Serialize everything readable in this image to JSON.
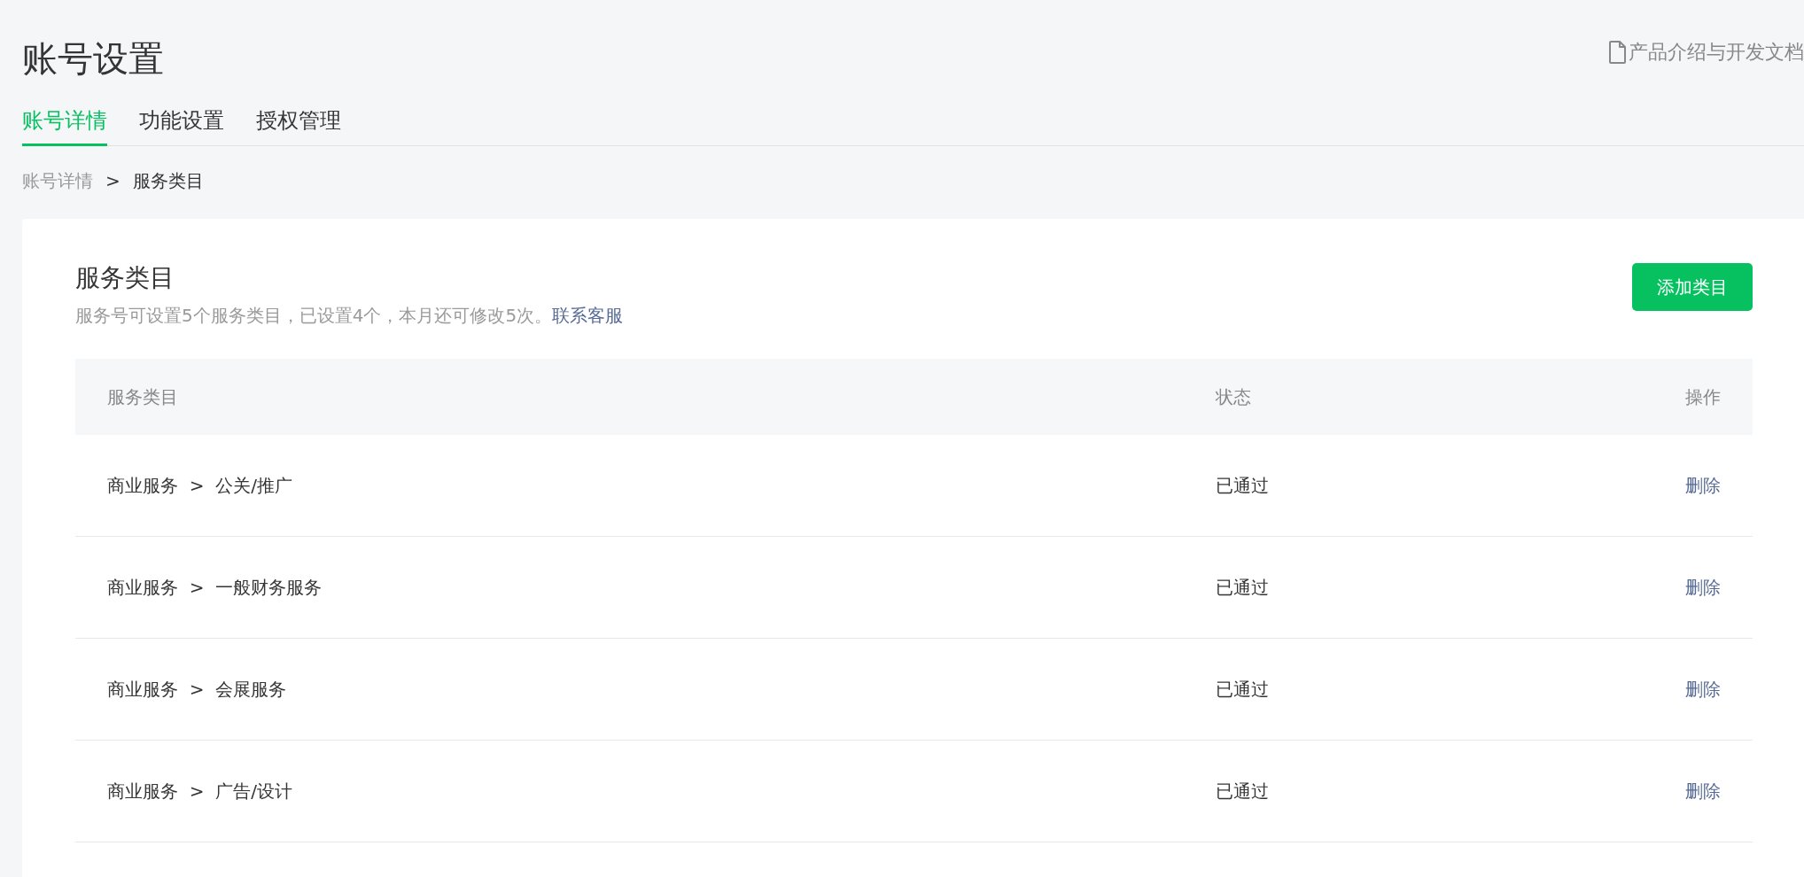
{
  "page": {
    "title": "账号设置",
    "doc_link": "产品介绍与开发文档"
  },
  "tabs": [
    {
      "label": "账号详情",
      "selected": true
    },
    {
      "label": "功能设置",
      "selected": false
    },
    {
      "label": "授权管理",
      "selected": false
    }
  ],
  "breadcrumb": {
    "separator": ">",
    "items": [
      {
        "label": "账号详情",
        "current": false
      },
      {
        "label": "服务类目",
        "current": true
      }
    ]
  },
  "card": {
    "title": "服务类目",
    "description": "服务号可设置5个服务类目，已设置4个，本月还可修改5次。",
    "description_link": "联系客服",
    "add_button": "添加类目"
  },
  "table": {
    "columns": [
      "服务类目",
      "状态",
      "操作"
    ],
    "rows": [
      {
        "category": "商业服务  >  公关/推广",
        "status": "已通过",
        "action": "删除"
      },
      {
        "category": "商业服务  >  一般财务服务",
        "status": "已通过",
        "action": "删除"
      },
      {
        "category": "商业服务  >  会展服务",
        "status": "已通过",
        "action": "删除"
      },
      {
        "category": "商业服务  >  广告/设计",
        "status": "已通过",
        "action": "删除"
      }
    ]
  }
}
